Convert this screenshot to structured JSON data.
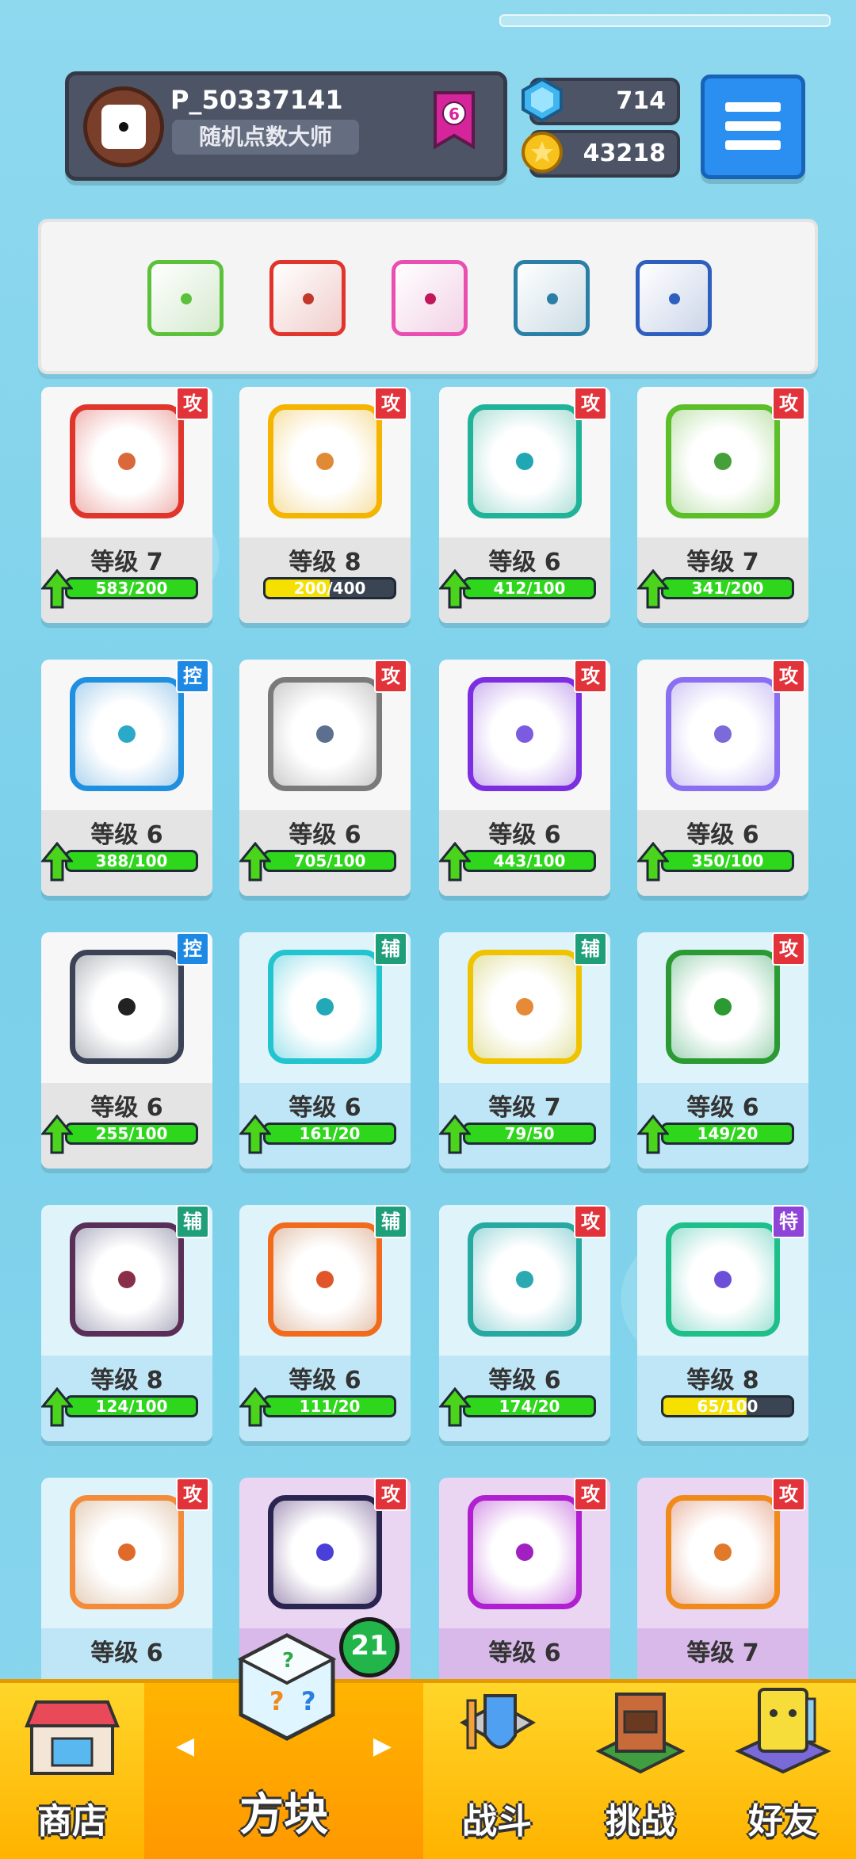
{
  "profile": {
    "name": "P_50337141",
    "title": "随机点数大师",
    "rank": "6"
  },
  "currency": {
    "gems": "714",
    "coins": "43218"
  },
  "deck": [
    {
      "icon": "biohazard-die-icon",
      "color": "#5cc13a",
      "pip": "#5cc13a"
    },
    {
      "icon": "fire-die-icon",
      "color": "#e0352b",
      "pip": "#c0392b"
    },
    {
      "icon": "shield-die-icon",
      "color": "#e94fb1",
      "pip": "#c2185b"
    },
    {
      "icon": "ice-dragon-die-icon",
      "color": "#2a7fa6",
      "pip": "#2a7fa6"
    },
    {
      "icon": "snowflake-die-icon",
      "color": "#2e5fbf",
      "pip": "#2e5fbf"
    }
  ],
  "cards": [
    {
      "icon": "fire-die-icon",
      "color": "#e0352b",
      "pip": "#d9693a",
      "tag": "攻",
      "tagColor": "#e2323a",
      "level": "等级 7",
      "progress": "583/200",
      "ratio": 1.0,
      "fill": "#2ed61c",
      "up": true,
      "bg": "gray"
    },
    {
      "icon": "electric-die-icon",
      "color": "#f4b400",
      "pip": "#e08a36",
      "tag": "攻",
      "tagColor": "#e2323a",
      "level": "等级 8",
      "progress": "200/400",
      "ratio": 0.5,
      "fill": "#f5e000",
      "up": false,
      "bg": "gray"
    },
    {
      "icon": "wind-die-icon",
      "color": "#21b39a",
      "pip": "#21a7b3",
      "tag": "攻",
      "tagColor": "#e2323a",
      "level": "等级 6",
      "progress": "412/100",
      "ratio": 1.0,
      "fill": "#2ed61c",
      "up": true,
      "bg": "gray"
    },
    {
      "icon": "poison-die-icon",
      "color": "#5cbf2a",
      "pip": "#46a03a",
      "tag": "攻",
      "tagColor": "#e2323a",
      "level": "等级 7",
      "progress": "341/200",
      "ratio": 1.0,
      "fill": "#2ed61c",
      "up": true,
      "bg": "gray"
    },
    {
      "icon": "ice-die-icon",
      "color": "#1f8fe0",
      "pip": "#2aa9c9",
      "tag": "控",
      "tagColor": "#1e88e5",
      "level": "等级 6",
      "progress": "388/100",
      "ratio": 1.0,
      "fill": "#2ed61c",
      "up": true,
      "bg": "gray"
    },
    {
      "icon": "iron-gear-die-icon",
      "color": "#7a7a7a",
      "pip": "#5c6f8f",
      "tag": "攻",
      "tagColor": "#e2323a",
      "level": "等级 6",
      "progress": "705/100",
      "ratio": 1.0,
      "fill": "#2ed61c",
      "up": true,
      "bg": "gray"
    },
    {
      "icon": "swap-arrows-die-icon",
      "color": "#7b2fe0",
      "pip": "#7b5ce0",
      "tag": "攻",
      "tagColor": "#e2323a",
      "level": "等级 6",
      "progress": "443/100",
      "ratio": 1.0,
      "fill": "#2ed61c",
      "up": true,
      "bg": "gray"
    },
    {
      "icon": "mystery-die-icon",
      "color": "#8b6ff2",
      "pip": "#7b6ad9",
      "tag": "攻",
      "tagColor": "#e2323a",
      "level": "等级 6",
      "progress": "350/100",
      "ratio": 1.0,
      "fill": "#2ed61c",
      "up": true,
      "bg": "gray"
    },
    {
      "icon": "lock-die-icon",
      "color": "#3c4356",
      "pip": "#222222",
      "tag": "控",
      "tagColor": "#1e88e5",
      "level": "等级 6",
      "progress": "255/100",
      "ratio": 1.0,
      "fill": "#2ed61c",
      "up": true,
      "bg": "gray"
    },
    {
      "icon": "heal-cross-die-icon",
      "color": "#22c4d0",
      "pip": "#22a9b8",
      "tag": "辅",
      "tagColor": "#1f9e7a",
      "level": "等级 6",
      "progress": "161/20",
      "ratio": 1.0,
      "fill": "#2ed61c",
      "up": true,
      "bg": "blue"
    },
    {
      "icon": "growth-die-icon",
      "color": "#efc300",
      "pip": "#e58a36",
      "tag": "辅",
      "tagColor": "#1f9e7a",
      "level": "等级 7",
      "progress": "79/50",
      "ratio": 1.0,
      "fill": "#2ed61c",
      "up": true,
      "bg": "blue"
    },
    {
      "icon": "thorn-die-icon",
      "color": "#2b9a32",
      "pip": "#2b9a32",
      "tag": "攻",
      "tagColor": "#e2323a",
      "level": "等级 6",
      "progress": "149/20",
      "ratio": 1.0,
      "fill": "#2ed61c",
      "up": true,
      "bg": "blue"
    },
    {
      "icon": "cracked-shield-die-icon",
      "color": "#5a2f57",
      "pip": "#8a2f4a",
      "tag": "辅",
      "tagColor": "#1f9e7a",
      "level": "等级 8",
      "progress": "124/100",
      "ratio": 1.0,
      "fill": "#2ed61c",
      "up": true,
      "bg": "blue"
    },
    {
      "icon": "sword-die-icon",
      "color": "#f26b1d",
      "pip": "#e0552a",
      "tag": "辅",
      "tagColor": "#1f9e7a",
      "level": "等级 6",
      "progress": "111/20",
      "ratio": 1.0,
      "fill": "#2ed61c",
      "up": true,
      "bg": "blue"
    },
    {
      "icon": "burst-die-icon",
      "color": "#27a8a0",
      "pip": "#2aa9b0",
      "tag": "攻",
      "tagColor": "#e2323a",
      "level": "等级 6",
      "progress": "174/20",
      "ratio": 1.0,
      "fill": "#2ed61c",
      "up": true,
      "bg": "blue"
    },
    {
      "icon": "summon-hands-die-icon",
      "color": "#1fbf8a",
      "pip": "#6c4fd9",
      "tag": "特",
      "tagColor": "#8e44d6",
      "level": "等级 8",
      "progress": "65/100",
      "ratio": 0.65,
      "fill": "#f5e000",
      "up": false,
      "bg": "blue"
    },
    {
      "icon": "bow-die-icon",
      "color": "#f38b3a",
      "pip": "#e06a2a",
      "tag": "攻",
      "tagColor": "#e2323a",
      "level": "等级 6",
      "progress": "",
      "ratio": 0,
      "fill": "#2ed61c",
      "up": false,
      "bg": "blue"
    },
    {
      "icon": "crescent-die-icon",
      "color": "#2a2550",
      "pip": "#4a3fd9",
      "tag": "攻",
      "tagColor": "#e2323a",
      "level": "",
      "progress": "",
      "ratio": 0,
      "fill": "#2ed61c",
      "up": false,
      "bg": "purple"
    },
    {
      "icon": "pixel-die-icon",
      "color": "#b01fd0",
      "pip": "#a020c0",
      "tag": "攻",
      "tagColor": "#e2323a",
      "level": "等级 6",
      "progress": "",
      "ratio": 0,
      "fill": "#2ed61c",
      "up": false,
      "bg": "purple"
    },
    {
      "icon": "target-die-icon",
      "color": "#f08a1a",
      "pip": "#e07a2a",
      "tag": "攻",
      "tagColor": "#e2323a",
      "level": "等级 7",
      "progress": "",
      "ratio": 0,
      "fill": "#2ed61c",
      "up": false,
      "bg": "purple"
    }
  ],
  "nav": {
    "shop": "商店",
    "dice": "方块",
    "battle": "战斗",
    "challenge": "挑战",
    "friends": "好友",
    "badge": "21"
  }
}
